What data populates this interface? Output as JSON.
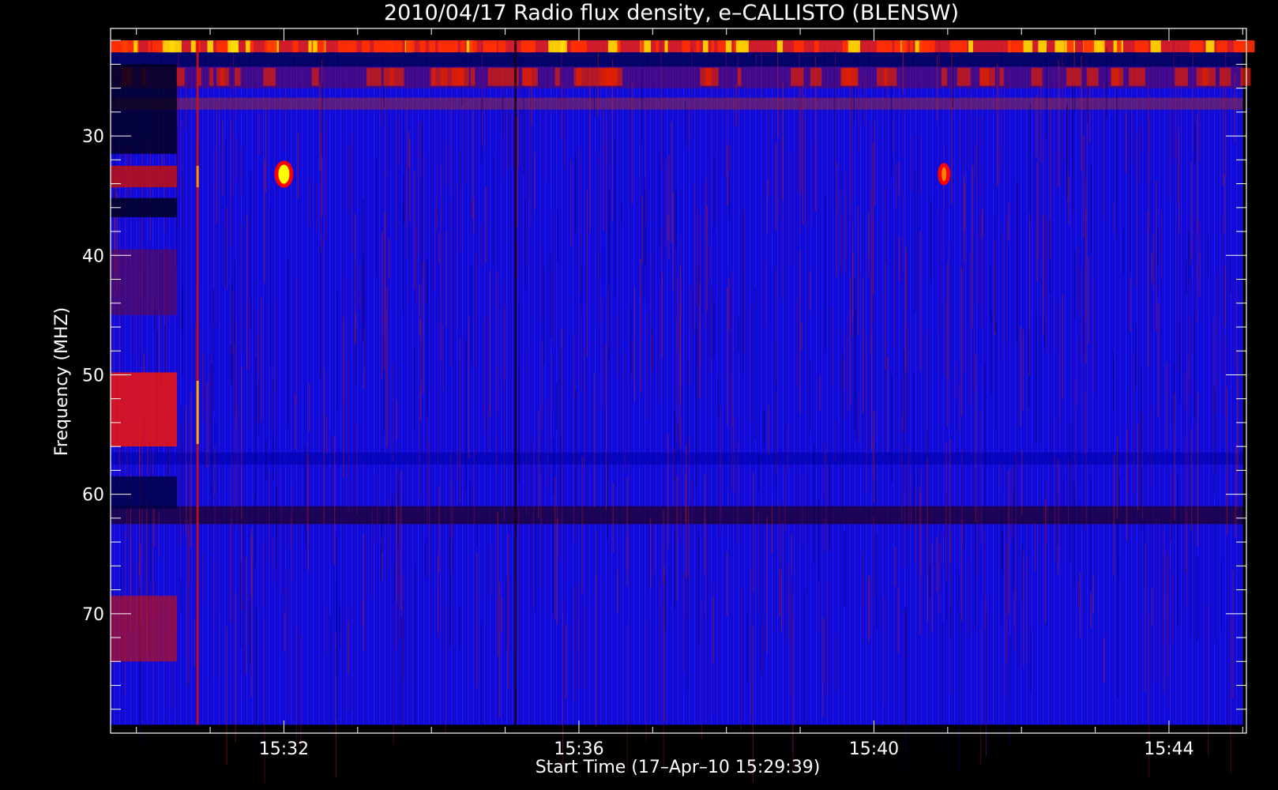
{
  "chart_data": {
    "type": "heatmap",
    "title": "2010/04/17  Radio flux density, e–CALLISTO (BLENSW)",
    "xlabel": "Start Time (17–Apr–10 15:29:39)",
    "ylabel": "Frequency (MHZ)",
    "x_tick_labels": [
      "15:32",
      "15:36",
      "15:40",
      "15:44"
    ],
    "x_tick_minutes": [
      32,
      36,
      40,
      44
    ],
    "y_tick_labels": [
      "30",
      "40",
      "50",
      "60",
      "70"
    ],
    "y_ticks": [
      30,
      40,
      50,
      60,
      70
    ],
    "xlim_minutes": [
      29.65,
      45.05
    ],
    "ylim": [
      80,
      21
    ],
    "data_time_range_minutes": [
      29.65,
      45.0
    ],
    "data_freq_range": [
      79.3,
      22.0
    ],
    "colormap": [
      "#000000",
      "#0000ff",
      "#ff0000",
      "#ffff00",
      "#ffffff"
    ],
    "background_color": "#0a0ae0",
    "features": [
      {
        "name": "burst-33mhz-1532",
        "time_minutes": 32.0,
        "freq_range": [
          32.2,
          34.2
        ],
        "level": "high"
      },
      {
        "name": "burst-33mhz-1541",
        "time_minutes": 40.95,
        "freq_range": [
          32.4,
          34.0
        ],
        "level": "medium"
      },
      {
        "name": "vertical-line-1531",
        "time_minutes": 30.83,
        "freq_range": [
          22.0,
          79.3
        ],
        "level": "medium"
      },
      {
        "name": "vertical-line-1535",
        "time_minutes": 35.14,
        "freq_range": [
          22.0,
          79.3
        ],
        "level": "low"
      },
      {
        "name": "band-top-22mhz",
        "time_minutes": 29.65,
        "freq_range": [
          22.0,
          23.0
        ],
        "level": "high"
      },
      {
        "name": "band-dark-61mhz",
        "time_minutes": 29.65,
        "freq_range": [
          61.0,
          62.5
        ],
        "level": "low"
      }
    ]
  }
}
